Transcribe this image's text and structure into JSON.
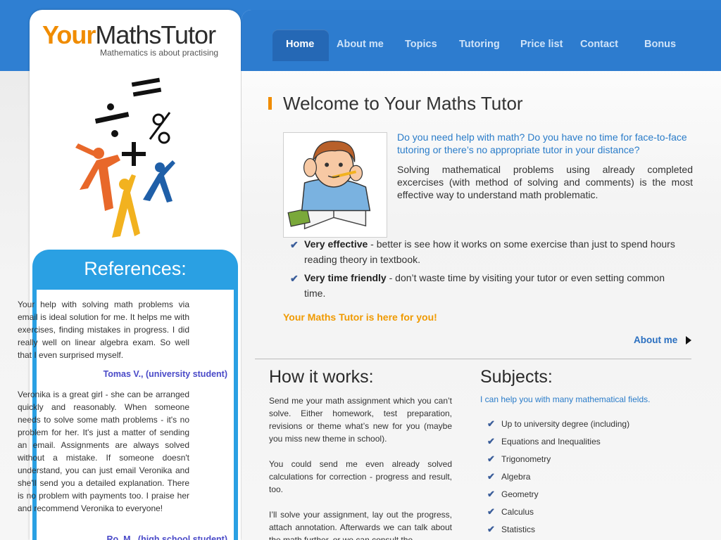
{
  "logo": {
    "part1": "Your",
    "part2": "MathsTutor",
    "tagline": "Mathematics is about practising"
  },
  "nav": {
    "items": [
      {
        "label": "Home",
        "active": true
      },
      {
        "label": "About me",
        "active": false
      },
      {
        "label": "Topics",
        "active": false
      },
      {
        "label": "Tutoring",
        "active": false
      },
      {
        "label": "Price list",
        "active": false
      },
      {
        "label": "Contact",
        "active": false
      },
      {
        "label": "Bonus",
        "active": false
      }
    ]
  },
  "references": {
    "title": "References:",
    "items": [
      {
        "text": "Your help with solving math problems via email is ideal solution for me. It helps me with exercises, finding mistakes in progress. I did really well on linear algebra exam. So well that I even surprised myself.",
        "author": "Tomas V., (university student)"
      },
      {
        "text": "Veronika is a great girl - she can be arranged quickly and reasonably. When someone needs to solve some math problems - it's no problem for her. It's just a matter of sending an email. Assignments are always solved without a mistake. If someone doesn't understand, you can just email Veronika and she'll send you a detailed explanation. There is no problem with payments too. I praise her and recommend Veronika to everyone!",
        "author": "Ro..M., (high school student)"
      }
    ]
  },
  "welcome": {
    "title": "Welcome to Your Maths Tutor",
    "question": "Do you need help with math? Do you have no time for face-to-face tutoring or there’s no appropriate tutor in your distance?",
    "paragraph": "Solving mathematical problems using already completed excercises (with method of solving and comments) is the most effective way to understand math problematic.",
    "bullets": [
      {
        "bold": "Very effective",
        "text": " - better is see how it works on some exercise than just to spend hours reading theory in textbook."
      },
      {
        "bold": "Very time friendly",
        "text": " - don’t waste time by visiting your tutor or even setting common time."
      }
    ],
    "here_for_you": "Your Maths Tutor is here for you!",
    "about_link": "About me"
  },
  "how_it_works": {
    "title": "How it works:",
    "paragraphs": [
      "Send me your math assignment which you can’t solve. Either homework, test preparation, revisions or theme what’s new for you (maybe you miss new theme in school).",
      "You could send me even already solved calculations for correction - progress and result, too.",
      "I’ll solve your assignment, lay out the progress, attach annotation. Afterwards we can talk about the math further, or we can consult the"
    ]
  },
  "subjects": {
    "title": "Subjects:",
    "intro": "I can help you with many mathematical fields.",
    "items": [
      "Up to university degree (including)",
      "Equations and Inequalities",
      "Trigonometry",
      "Algebra",
      "Geometry",
      "Calculus",
      "Statistics"
    ]
  },
  "colors": {
    "brand_blue": "#2d7ccf",
    "brand_orange": "#f08c00",
    "reference_blue": "#2aa0e3"
  },
  "icons": {
    "check": "checkmark-icon",
    "arrow": "play-arrow-icon",
    "illustration": "math-figures-illustration",
    "picture": "boy-studying-picture"
  }
}
